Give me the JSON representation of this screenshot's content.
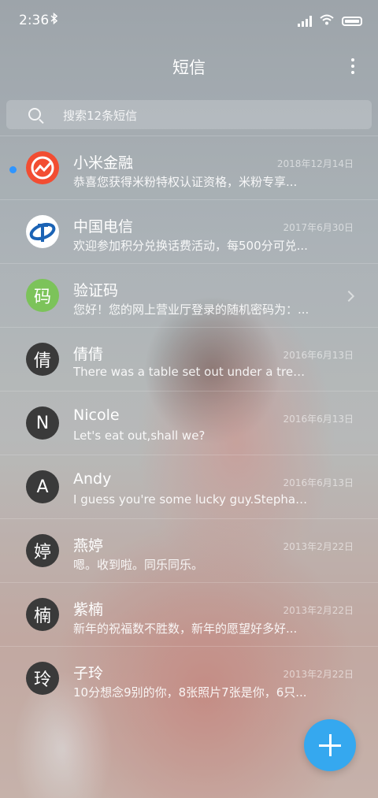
{
  "status_bar": {
    "time": "2:36",
    "bluetooth_icon": "bluetooth-icon",
    "signal_icon": "signal-icon",
    "wifi_icon": "wifi-icon",
    "battery_icon": "battery-icon"
  },
  "header": {
    "title": "短信",
    "more_icon": "more-vertical-icon"
  },
  "search": {
    "placeholder": "搜索12条短信",
    "icon": "search-icon"
  },
  "conversations": [
    {
      "name": "小米金融",
      "date": "2018年12月14日",
      "preview": "恭喜您获得米粉特权认证资格，米粉专享...",
      "avatar": "",
      "avatar_icon": "mi-finance-logo-icon",
      "unread": true
    },
    {
      "name": "中国电信",
      "date": "2017年6月30日",
      "preview": "欢迎参加积分兑换话费活动，每500分可兑...",
      "avatar": "",
      "avatar_icon": "china-telecom-logo-icon",
      "unread": false
    },
    {
      "name": "验证码",
      "date": "",
      "preview": "您好！您的网上营业厅登录的随机密码为：...",
      "avatar": "码",
      "has_chevron": true,
      "unread": false
    },
    {
      "name": "倩倩",
      "date": "2016年6月13日",
      "preview": "There was a table set out under a tree in...",
      "avatar": "倩",
      "unread": false
    },
    {
      "name": "Nicole",
      "date": "2016年6月13日",
      "preview": "Let's eat out,shall we?",
      "avatar": "N",
      "unread": false
    },
    {
      "name": "Andy",
      "date": "2016年6月13日",
      "preview": "I guess you're some lucky guy.Stephani...",
      "avatar": "A",
      "unread": false
    },
    {
      "name": "燕婷",
      "date": "2013年2月22日",
      "preview": "嗯。收到啦。同乐同乐。",
      "avatar": "婷",
      "unread": false
    },
    {
      "name": "紫楠",
      "date": "2013年2月22日",
      "preview": "新年的祝福数不胜数，新年的愿望好多好...",
      "avatar": "楠",
      "unread": false
    },
    {
      "name": "子玲",
      "date": "2013年2月22日",
      "preview": "10分想念9别的你，8张照片7张是你，6只...",
      "avatar": "玲",
      "unread": false
    }
  ],
  "fab": {
    "icon": "plus-icon",
    "color": "#35a8ef"
  },
  "colors": {
    "unread_dot": "#2f95ff",
    "mi_red": "#f24d32",
    "code_green": "#7cc35a",
    "telecom_blue": "#1b63b5"
  }
}
